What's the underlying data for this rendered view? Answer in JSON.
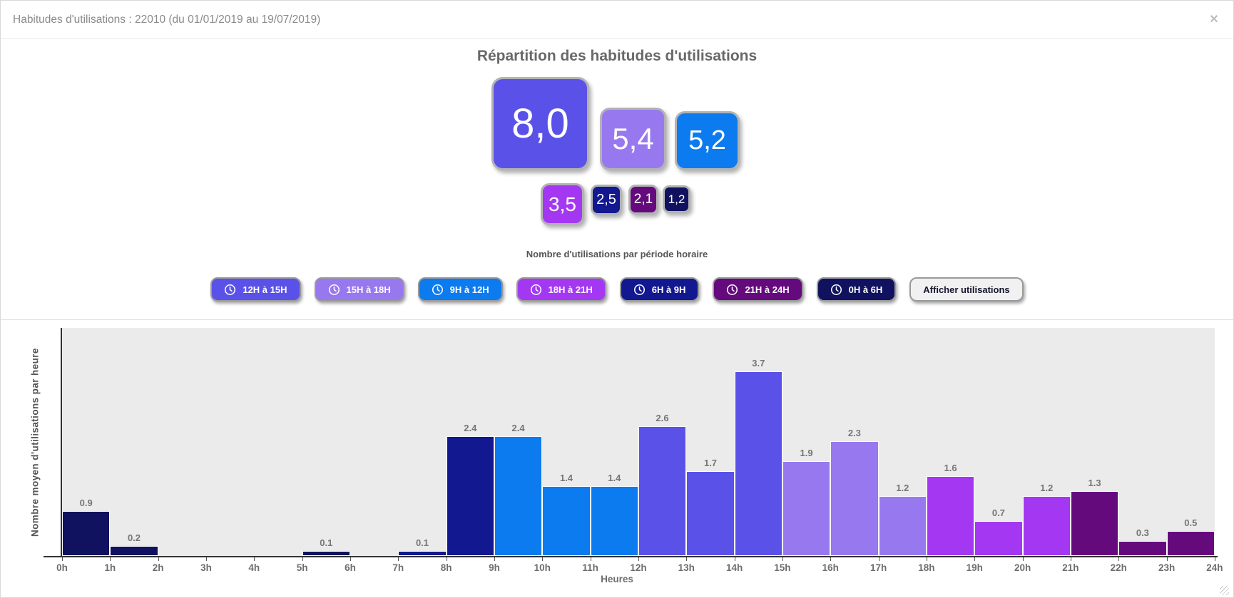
{
  "modal": {
    "title": "Habitudes d'utilisations : 22010 (du 01/01/2019 au 19/07/2019)",
    "close_glyph": "✕"
  },
  "main": {
    "title": "Répartition des habitudes d'utilisations",
    "subtitle": "Nombre d'utilisations par période horaire"
  },
  "periods": [
    {
      "label": "12H à 15H",
      "color": "#5a52e8"
    },
    {
      "label": "15H à 18H",
      "color": "#9878ef"
    },
    {
      "label": "9H à 12H",
      "color": "#0b7bef"
    },
    {
      "label": "18H à 21H",
      "color": "#a438f2"
    },
    {
      "label": "6H à 9H",
      "color": "#12188f"
    },
    {
      "label": "21H à 24H",
      "color": "#650a7d"
    },
    {
      "label": "0H à 6H",
      "color": "#10125f"
    }
  ],
  "bubbles": [
    {
      "label": "8,0",
      "value": 8.0,
      "period_index": 0
    },
    {
      "label": "5,4",
      "value": 5.4,
      "period_index": 1
    },
    {
      "label": "5,2",
      "value": 5.2,
      "period_index": 2
    },
    {
      "label": "3,5",
      "value": 3.5,
      "period_index": 3
    },
    {
      "label": "2,5",
      "value": 2.5,
      "period_index": 4
    },
    {
      "label": "2,1",
      "value": 2.1,
      "period_index": 5
    },
    {
      "label": "1,2",
      "value": 1.2,
      "period_index": 6
    }
  ],
  "legend": {
    "period_button_order": [
      0,
      1,
      2,
      3,
      4,
      5,
      6
    ],
    "action_button": {
      "label": "Afficher utilisations",
      "bg": "#f1f1f1",
      "text_color": "#15152e"
    }
  },
  "chart_data": {
    "type": "bar",
    "title": "Nombre d'utilisations par période horaire",
    "xlabel": "Heures",
    "ylabel": "Nombre moyen d'utilisations par heure",
    "x_tick_labels": [
      "0h",
      "1h",
      "2h",
      "3h",
      "4h",
      "5h",
      "6h",
      "7h",
      "8h",
      "9h",
      "10h",
      "11h",
      "12h",
      "13h",
      "14h",
      "15h",
      "16h",
      "17h",
      "18h",
      "19h",
      "20h",
      "21h",
      "22h",
      "23h",
      "24h"
    ],
    "values": [
      0.9,
      0.2,
      0,
      0,
      0,
      0.1,
      0,
      0.1,
      2.4,
      2.4,
      1.4,
      1.4,
      2.6,
      1.7,
      3.7,
      1.9,
      2.3,
      1.2,
      1.6,
      0.7,
      1.2,
      1.3,
      0.3,
      0.5
    ],
    "bar_labels": [
      "0.9",
      "0.2",
      "",
      "",
      "",
      "0.1",
      "",
      "0.1",
      "2.4",
      "2.4",
      "1.4",
      "1.4",
      "2.6",
      "1.7",
      "3.7",
      "1.9",
      "2.3",
      "1.2",
      "1.6",
      "0.7",
      "1.2",
      "1.3",
      "0.3",
      "0.5"
    ],
    "bar_period_index": [
      6,
      6,
      6,
      6,
      6,
      6,
      4,
      4,
      4,
      2,
      2,
      2,
      0,
      0,
      0,
      1,
      1,
      1,
      3,
      3,
      3,
      5,
      5,
      5
    ],
    "ylim": [
      0,
      4.57
    ],
    "grid": false,
    "plot_background": "#ebebeb",
    "axis_color": "#333333"
  }
}
